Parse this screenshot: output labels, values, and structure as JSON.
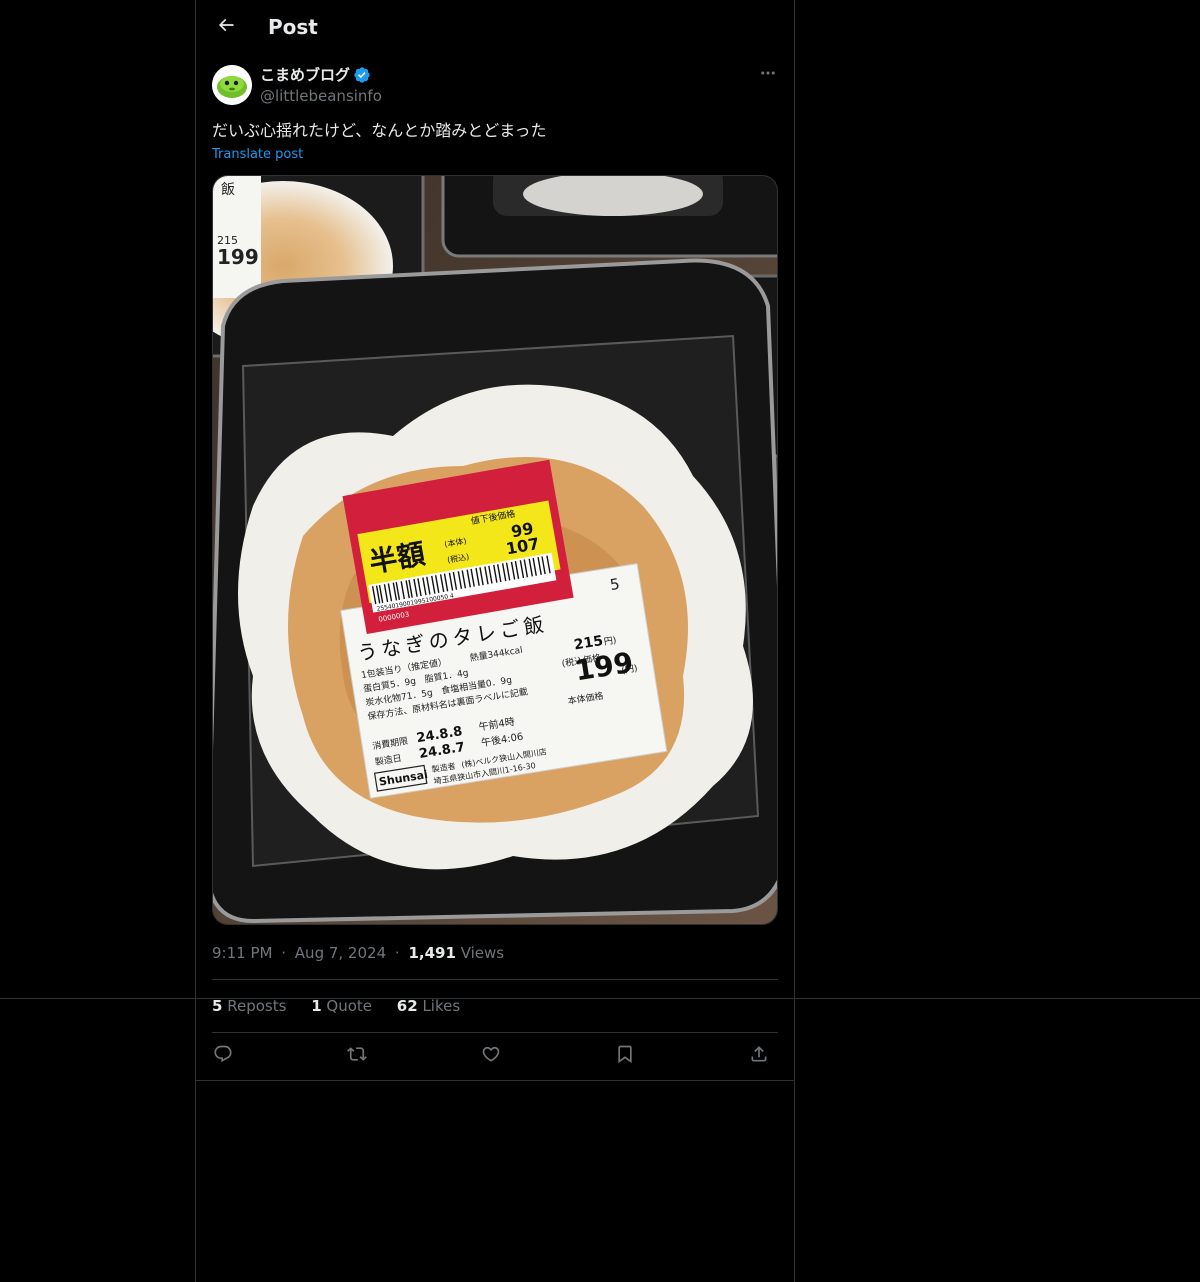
{
  "header": {
    "title": "Post",
    "back_icon": "arrow-left-icon"
  },
  "author": {
    "display_name": "こまめブログ",
    "handle": "@littlebeansinfo",
    "verified": true,
    "verified_color": "#1d9bf0",
    "avatar_icon": "green-bean-avatar"
  },
  "post": {
    "text": "だいぶ心揺れたけど、なんとか踏みとどまった",
    "translate_label": "Translate post"
  },
  "media": {
    "label": {
      "discount_stamp": "半額",
      "discount_heading": "値下後価格",
      "discount_price_excl_label": "(本体)",
      "discount_price_excl": "99",
      "discount_price_incl_label": "(税込)",
      "discount_price_incl": "107",
      "barcode_number": "2554019001995100050 4",
      "barcode_sub": "0000003",
      "product_code": "5",
      "product_name": "うなぎのタレご飯",
      "nutrition_header": "1包装当り（推定値）",
      "calories": "熱量344kcal",
      "nutrition_line1": "蛋白質5．9g　脂質1．4g",
      "nutrition_line2": "炭水化物71．5g　食塩相当量0．9g",
      "storage": "保存方法、原材料名は裏面ラベルに記載",
      "tax_incl_label": "(税込価格",
      "price_incl": "215",
      "price_incl_unit": "円)",
      "price_excl": "199",
      "price_excl_unit": "(円)",
      "price_excl_label": "本体価格",
      "expiry_label": "消費期限",
      "expiry_date": "24.8.8",
      "expiry_time": "午前4時",
      "made_label": "製造日",
      "made_date": "24.8.7",
      "made_time": "午後4:06",
      "brand": "Shunsai",
      "maker_label": "製造者",
      "maker": "(株)ベルク狭山入間川店",
      "address": "埼玉県狭山市入間川1-16-30"
    }
  },
  "meta": {
    "time": "9:11 PM",
    "separator": "·",
    "date": "Aug 7, 2024",
    "views_count": "1,491",
    "views_label": "Views"
  },
  "stats": {
    "reposts_count": "5",
    "reposts_label": "Reposts",
    "quotes_count": "1",
    "quotes_label": "Quote",
    "likes_count": "62",
    "likes_label": "Likes"
  },
  "actions": [
    "reply-icon",
    "repost-icon",
    "like-icon",
    "bookmark-icon",
    "share-icon"
  ],
  "colors": {
    "background": "#000000",
    "text": "#e7e9ea",
    "muted": "#71767b",
    "accent": "#1d9bf0",
    "border": "#2f3336"
  }
}
